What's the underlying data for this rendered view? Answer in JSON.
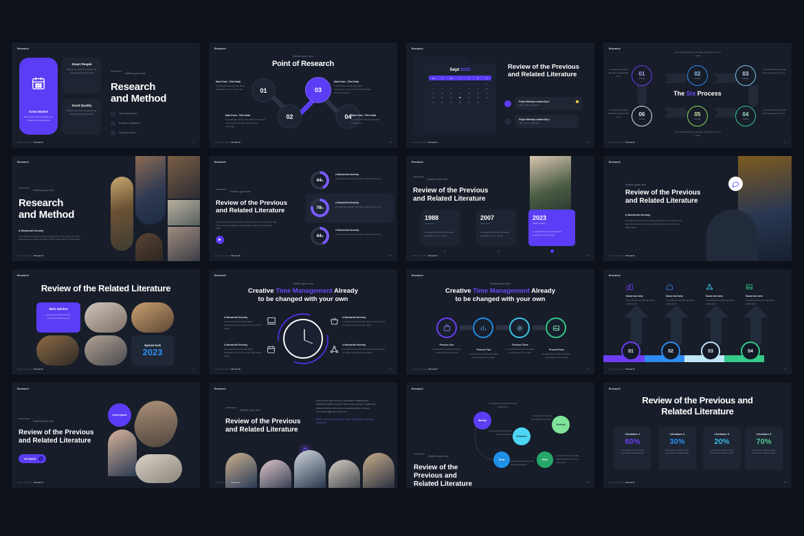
{
  "meta": {
    "background": "#0c111a",
    "slide_bg": "#171d29",
    "accent_purple": "#5b3df5",
    "accent_blue": "#2d8cf0",
    "accent_cyan": "#39b6ea",
    "accent_green": "#35c98a",
    "brand": "Research",
    "footer_text": "Learn more about ",
    "footer_brand": "Research"
  },
  "slides": [
    {
      "id": "s1",
      "header": "Research",
      "page": "8",
      "subtitle": "Subtitle goes here",
      "title_line1": "Research",
      "title_line2": "and Method",
      "cards": [
        {
          "title": "Great Market",
          "body": "Behind the word mountains, far Vocalia and Consonantia"
        },
        {
          "title": "Smart People",
          "body": "Behind the word mountains, far Vocalia and Consonantia"
        },
        {
          "title": "Good Quality",
          "body": "Behind the word mountains, far Vocalia and Consonantia"
        }
      ],
      "checklist": [
        "The Great Decision",
        "Complete Installations",
        "The great decision"
      ],
      "icon": "calendar-icon"
    },
    {
      "id": "s2",
      "header": "Research",
      "page": "18",
      "subtitle": "Subtitle goes here",
      "title": "Point of Research",
      "nodes": [
        {
          "num": "01",
          "title": "Main Point - Title Detail",
          "body": "A wonderful serenity has taken possession of my entire soul.",
          "active": false
        },
        {
          "num": "02",
          "title": "Main Point - Title Detail",
          "body": "A wonderful serenity has taken possession of my entire soul, like these sweet mornings.",
          "active": false
        },
        {
          "num": "03",
          "title": "Main Point - Title Detail",
          "body": "A wonderful serenity has taken possession of my entire soul, like those sweet mornings.",
          "active": true
        },
        {
          "num": "04",
          "title": "Main Point - Title Detail",
          "body": "A wonderful serenity has taken possession.",
          "active": false
        }
      ]
    },
    {
      "id": "s3",
      "header": "Research",
      "page": "33",
      "month": "Sept",
      "year": "2023",
      "weekdays": [
        "M",
        "T",
        "W",
        "T",
        "F",
        "S",
        "S"
      ],
      "days": [
        "28",
        "29",
        "30",
        "31",
        "1",
        "2",
        "3",
        "4",
        "5",
        "6",
        "7",
        "8",
        "9",
        "10",
        "11",
        "12",
        "13",
        "14",
        "15",
        "16",
        "17",
        "18",
        "19",
        "20",
        "21",
        "22",
        "23",
        "24",
        "25",
        "26",
        "27",
        "28",
        "29",
        "30",
        "1",
        "2",
        "3",
        "4",
        "5",
        "6",
        "7",
        "8"
      ],
      "today": "21",
      "title": "Review of the Previous and Related Literature",
      "events": [
        {
          "title": "Project Meetup London Day 1",
          "sub": "TBD, 10 AM - Royal Hall",
          "active": true
        },
        {
          "title": "Project Meetup London Day 2",
          "sub": "TBD, 10 AM - Royal Hall",
          "active": false
        }
      ]
    },
    {
      "id": "s4",
      "header": "Research",
      "page": "47",
      "title_pre": "The ",
      "title_accent": "Six",
      "title_post": " Process",
      "steps": [
        {
          "num": "01",
          "label": "Average",
          "color": "#6e3df5",
          "body": "A wonderful serenity has taken possession of my"
        },
        {
          "num": "02",
          "label": "Average",
          "color": "#2d8cf0",
          "body": "A wonderful serenity has taken possession of my entire"
        },
        {
          "num": "03",
          "label": "Average",
          "color": "#7fc6ef",
          "body": "A wonderful serenity has taken possession of my"
        },
        {
          "num": "04",
          "label": "Average",
          "color": "#35c98a",
          "body": "A wonderful serenity has taken possession of my"
        },
        {
          "num": "05",
          "label": "Average",
          "color": "#8ede5a",
          "body": "A wonderful serenity has taken possession of my entire"
        },
        {
          "num": "06",
          "label": "Average",
          "color": "#dfe5f0",
          "body": "A wonderful serenity has taken possession of my"
        }
      ]
    },
    {
      "id": "s5",
      "header": "Research",
      "page": "4",
      "subtitle": "Subtitle goes here",
      "title_line1": "Research",
      "title_line2": "and Method",
      "body_title": "A Wonderful Serenity",
      "body": "A wonderful serenity has taken possession of my entire soul, like these sweet mornings of spring which I enjoy with my whole heart."
    },
    {
      "id": "s6",
      "header": "Research",
      "page": "39",
      "subtitle": "Subtitle goes here",
      "title": "Review of the Previous and Related Literature",
      "body": "A wonderful serenity has taken possession of my entire soul, like these sweet mornings of spring which I enjoy with my whole heart.",
      "stats": [
        {
          "value": "44",
          "unit": "%",
          "title": "A Wonderful Serenity",
          "body": "A wonderful serenity has taken possession of my",
          "active": false
        },
        {
          "value": "78",
          "unit": "%",
          "title": "A Wonderful Serenity",
          "body": "A wonderful serenity has taken possession of my",
          "active": true
        },
        {
          "value": "44",
          "unit": "%",
          "title": "A Wonderful Serenity",
          "body": "A wonderful serenity has taken possession of my",
          "active": false
        }
      ]
    },
    {
      "id": "s7",
      "header": "Research",
      "page": "33",
      "subtitle": "Subtitle goes here",
      "title": "Review of the Previous and Related Literature",
      "years": [
        {
          "year": "1988",
          "sub": "",
          "body": "A wonderful serenity has taken possession of my entire",
          "active": false
        },
        {
          "year": "2007",
          "sub": "",
          "body": "A wonderful serenity has taken possession of my entire",
          "active": false
        },
        {
          "year": "2023",
          "sub": "Dublin College",
          "body": "A wonderful serenity has taken possession of my entire",
          "active": true
        }
      ]
    },
    {
      "id": "s8",
      "header": "Research",
      "page": "5",
      "subtitle": "Subtitle goes here",
      "title": "Review of the Previous and Related Literature",
      "body_title": "A Wonderful Serenity",
      "body": "A wonderful serenity has taken possession of my entire soul, like these sweet mornings of spring which I enjoy with my whole heart.",
      "icon": "chat-icon"
    },
    {
      "id": "s9",
      "header": "Research",
      "page": "6",
      "title": "Review of the Related Literature",
      "main_card": {
        "title": "Main opinion",
        "body": "Lorem ipsum dolor sit amet, consectetur adipiscing elit"
      },
      "special_card": {
        "title": "Special task",
        "year": "2023"
      }
    },
    {
      "id": "s10",
      "header": "Research",
      "page": "40",
      "subtitle": "Subtitle goes here",
      "title_pre": "Creative ",
      "title_accent": "Time Management",
      "title_post": " Already",
      "title_line2": "to be changed with your own",
      "features": [
        {
          "title": "A Wonderful Serenity",
          "body": "A wonderful serenity has taken possession of my entire soul, like those sweet",
          "icon": "laptop-icon"
        },
        {
          "title": "A Wonderful Serenity",
          "body": "A wonderful serenity has taken possession of my entire soul, like those sweet",
          "icon": "calendar-icon"
        },
        {
          "title": "A Wonderful Serenity",
          "body": "A wonderful serenity has taken possession of my entire soul, like those sweet",
          "icon": "basket-icon"
        },
        {
          "title": "A Wonderful Serenity",
          "body": "A wonderful serenity has taken possession of my entire soul, like those sweet",
          "icon": "network-icon"
        }
      ]
    },
    {
      "id": "s11",
      "header": "Research",
      "page": "52",
      "subtitle": "Subtitle goes here",
      "title_pre": "Creative ",
      "title_accent": "Time Management",
      "title_post": " Already",
      "title_line2": "to be changed with your own",
      "processes": [
        {
          "title": "Process One",
          "body": "A wonderful serenity has taken possession of my entire",
          "color": "#6e3df5",
          "icon": "bag-icon"
        },
        {
          "title": "Process Two",
          "body": "A wonderful serenity has taken possession of my entire",
          "color": "#1f8fe8",
          "icon": "chart-icon"
        },
        {
          "title": "Process Three",
          "body": "A wonderful serenity has taken possession of my entire",
          "color": "#39c6ea",
          "icon": "gear-icon"
        },
        {
          "title": "Process Four",
          "body": "A wonderful serenity has taken possession of my entire",
          "color": "#35c98a",
          "icon": "image-icon"
        }
      ]
    },
    {
      "id": "s12",
      "header": "Research",
      "page": "44",
      "steps": [
        {
          "num": "01",
          "title": "Some text here",
          "body": "A wonderful serenity has taken possession",
          "color": "#6e3df5",
          "icon": "buildings-icon"
        },
        {
          "num": "02",
          "title": "Some text here",
          "body": "A wonderful serenity has taken possession",
          "color": "#2d8cf0",
          "icon": "home-icon"
        },
        {
          "num": "03",
          "title": "Some text here",
          "body": "A wonderful serenity has taken possession",
          "color": "#bfe6f7",
          "icon": "network-icon"
        },
        {
          "num": "04",
          "title": "Some text here",
          "body": "A wonderful serenity has taken possession",
          "color": "#35c98a",
          "icon": "image-icon"
        }
      ]
    },
    {
      "id": "s13",
      "header": "Research",
      "page": "7",
      "subtitle": "Subtitle goes here",
      "title": "Review of the Previous and Related Literature",
      "bubble_label": "Lorem ipsum",
      "cta": "Get Started",
      "cta_icon": "arrow-right-icon"
    },
    {
      "id": "s14",
      "header": "Research",
      "page": "11",
      "subtitle": "Subtitle goes here",
      "title": "Review of the Previous and Related Literature",
      "body": "Lorem ipsum dolor sit amet, consectetuer adipiscing elit. Maecenas porttitor congue massa. Fusce posuere, magna sed pulvinar ultricies, purus lectus malesuada libero, sit amet commodo magna eros quis urna.",
      "link": "Morbi in sem quis dui placerat ornare. Pellentesque odio nisi, euismod in.",
      "icon": "bag-icon"
    },
    {
      "id": "s15",
      "header": "Research",
      "page": "35",
      "subtitle": "Subtitle goes here",
      "title": "Review of the Previous and Related Literature",
      "bubbles": [
        {
          "label": "StartUp",
          "color": "#5b3df5",
          "body": "A wonderful serenity has taken possession"
        },
        {
          "label": "Research",
          "color": "#4ed6f5",
          "body": "A wonderful serenity has taken possession"
        },
        {
          "label": "Grow",
          "color": "#1f8fe8",
          "body": "A wonderful serenity has taken possession"
        },
        {
          "label": "Develop",
          "color": "#7fe39a",
          "body": "A wonderful serenity has taken possession"
        },
        {
          "label": "Work",
          "color": "#27a86b",
          "body": "A wonderful serenity has taken possession of my entire soul"
        }
      ]
    },
    {
      "id": "s16",
      "header": "Research",
      "page": "38",
      "title_line1": "Review of the Previous and",
      "title_line2": "Related Literature",
      "items": [
        {
          "title": "Literature 1",
          "percent": "60%",
          "color": "#6e3df5",
          "body": "Lorem ipsum dolor sit amet, consectetuer adipiscing elit."
        },
        {
          "title": "Literature 2",
          "percent": "30%",
          "color": "#2d8cf0",
          "body": "Lorem ipsum dolor sit amet, consectetuer adipiscing elit."
        },
        {
          "title": "Literature 3",
          "percent": "20%",
          "color": "#39b6ea",
          "body": "Lorem ipsum dolor sit amet, consectetuer adipiscing elit."
        },
        {
          "title": "Literature 4",
          "percent": "70%",
          "color": "#4fc98f",
          "body": "Lorem ipsum dolor sit amet, consectetuer adipiscing elit."
        }
      ]
    }
  ]
}
